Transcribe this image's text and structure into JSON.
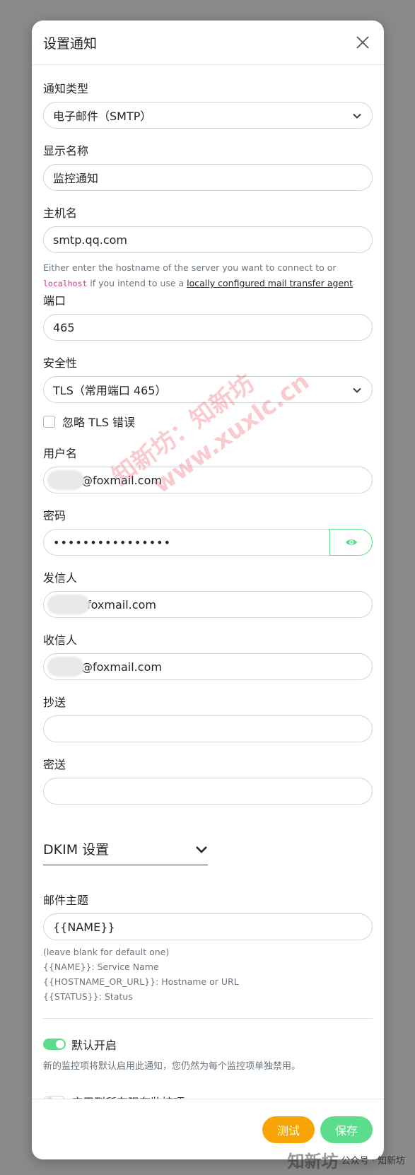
{
  "modal": {
    "title": "设置通知"
  },
  "fields": {
    "type": {
      "label": "通知类型",
      "value": "电子邮件（SMTP）"
    },
    "display_name": {
      "label": "显示名称",
      "value": "监控通知"
    },
    "hostname": {
      "label": "主机名",
      "value": "smtp.qq.com",
      "hint_before": "Either enter the hostname of the server you want to connect to or",
      "hint_code": "localhost",
      "hint_mid": " if you intend to use a ",
      "hint_link": "locally configured mail transfer agent"
    },
    "port": {
      "label": "端口",
      "value": "465"
    },
    "security": {
      "label": "安全性",
      "value": "TLS（常用端口 465）"
    },
    "ignore_tls": {
      "label": "忽略 TLS 错误"
    },
    "username": {
      "label": "用户名",
      "value": "@foxmail.com"
    },
    "password": {
      "label": "密码",
      "value": "••••••••••••••••"
    },
    "from": {
      "label": "发信人",
      "value": "foxmail.com"
    },
    "to": {
      "label": "收信人",
      "value": "@foxmail.com"
    },
    "cc": {
      "label": "抄送",
      "value": ""
    },
    "bcc": {
      "label": "密送",
      "value": ""
    },
    "dkim": {
      "title": "DKIM 设置"
    },
    "subject": {
      "label": "邮件主题",
      "value": "{{NAME}}",
      "hint_lines": [
        "(leave blank for default one)",
        "{{NAME}}: Service Name",
        "{{HOSTNAME_OR_URL}}: Hostname or URL",
        "{{STATUS}}: Status"
      ]
    }
  },
  "toggles": {
    "default_enabled": {
      "label": "默认开启",
      "description": "新的监控项将默认启用此通知，您仍然为每个监控项单独禁用。",
      "state": "on"
    },
    "apply_existing": {
      "label": "应用到所有现有监控项",
      "state": "off"
    }
  },
  "footer": {
    "test_label": "测试",
    "save_label": "保存"
  },
  "watermark": {
    "line1": "知新坊：知新坊",
    "line2": "www.xuxlc.cn"
  },
  "corner": {
    "logo": "知新坊",
    "caption": "公众号 · 知新坊"
  },
  "colors": {
    "primary_green": "#5cdd8b",
    "test_orange": "#f8a306",
    "code_pink": "#d63384"
  }
}
